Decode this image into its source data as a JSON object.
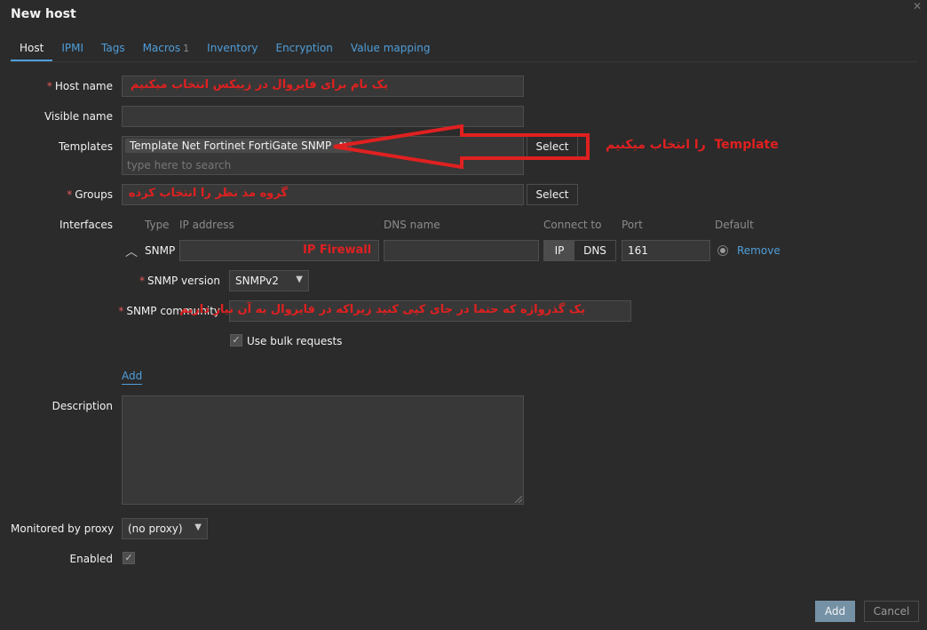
{
  "dialog": {
    "title": "New host"
  },
  "tabs": [
    {
      "label": "Host"
    },
    {
      "label": "IPMI"
    },
    {
      "label": "Tags"
    },
    {
      "label": "Macros",
      "count": "1"
    },
    {
      "label": "Inventory"
    },
    {
      "label": "Encryption"
    },
    {
      "label": "Value mapping"
    }
  ],
  "form": {
    "host_name_label": "Host name",
    "host_name_annotation": "یک نام برای فایروال  در زبیکس انتخاب میکنیم",
    "visible_name_label": "Visible name",
    "templates_label": "Templates",
    "template_tag": "Template Net Fortinet FortiGate SNMP",
    "template_placeholder": "type here to search",
    "templates_select": "Select",
    "templates_annotation_en": "Template",
    "templates_annotation_fa": "را انتخاب میکنیم",
    "groups_label": "Groups",
    "groups_annotation": "گروه مد نظر را انتخاب کرده",
    "groups_select": "Select",
    "interfaces_label": "Interfaces",
    "description_label": "Description",
    "proxy_label": "Monitored by proxy",
    "proxy_value": "(no proxy)",
    "enabled_label": "Enabled"
  },
  "interfaces": {
    "headers": {
      "type": "Type",
      "ip": "IP address",
      "dns": "DNS name",
      "connect": "Connect to",
      "port": "Port",
      "default": "Default"
    },
    "row": {
      "type": "SNMP",
      "ip_annotation": "IP Firewall",
      "connect_ip": "IP",
      "connect_dns": "DNS",
      "port": "161",
      "remove": "Remove"
    },
    "snmp_version_label": "SNMP version",
    "snmp_version_value": "SNMPv2",
    "snmp_community_label": "SNMP community",
    "snmp_community_annotation": "یک گذرواژه  که حتما در جای کپی کنید زیراکه در فایروال به آن نیاز داریم",
    "bulk_label": "Use bulk requests",
    "add_link": "Add"
  },
  "footer": {
    "add": "Add",
    "cancel": "Cancel"
  },
  "colors": {
    "background": "#2b2b2b",
    "field": "#383838",
    "link": "#4f9ed9",
    "annotation": "#e02020",
    "primary_button": "#7591a6"
  }
}
